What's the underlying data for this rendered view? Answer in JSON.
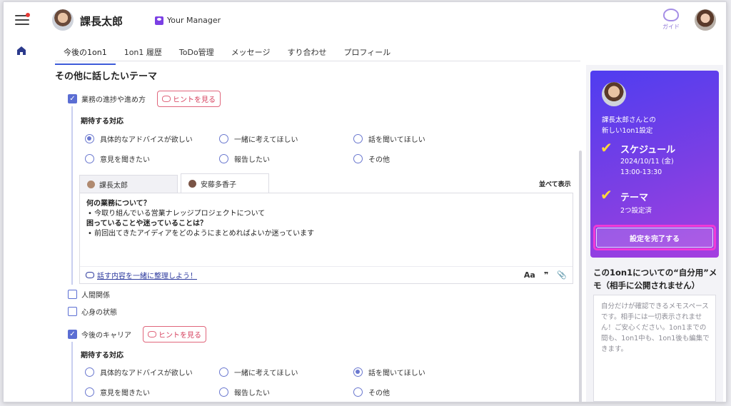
{
  "header": {
    "user_name": "課長太郎",
    "manager_badge": "Your Manager",
    "guide_label": "ガイド"
  },
  "tabs": [
    {
      "label": "今後の1on1",
      "active": true
    },
    {
      "label": "1on1 履歴"
    },
    {
      "label": "ToDo管理"
    },
    {
      "label": "メッセージ"
    },
    {
      "label": "すり合わせ"
    },
    {
      "label": "プロフィール"
    }
  ],
  "main": {
    "section_title": "その他に話したいテーマ",
    "hint_label": "ヒントを見る",
    "expected_label": "期待する対応",
    "themes": [
      {
        "label": "業務の進捗や進め方",
        "checked": true
      },
      {
        "label": "人間関係",
        "checked": false
      },
      {
        "label": "心身の状態",
        "checked": false
      },
      {
        "label": "今後のキャリア",
        "checked": true
      }
    ],
    "options": [
      "具体的なアドバイスが欲しい",
      "一緒に考えてほしい",
      "話を聞いてほしい",
      "意見を聞きたい",
      "報告したい",
      "その他"
    ],
    "group1_selected": 0,
    "group2_selected": 2,
    "note_tabs": [
      "課長太郎",
      "安藤多香子"
    ],
    "side_by_side": "並べて表示",
    "note_lines": [
      {
        "text": "何の業務について？",
        "bold": true
      },
      {
        "text": "• 今取り組んでいる営業ナレッジプロジェクトについて",
        "bold": false
      },
      {
        "text": "困っていることや迷っていることは？",
        "bold": true
      },
      {
        "text": "• 前回出てきたアイディアをどのようにまとめればよいか迷っています",
        "bold": false
      }
    ],
    "organize_link": "話す内容を一緒に整理しよう！",
    "format_icons": [
      "Aa",
      "❞",
      "📎"
    ]
  },
  "card": {
    "subtitle_line1": "課長太郎さんとの",
    "subtitle_line2": "新しい1on1設定",
    "schedule_title": "スケジュール",
    "schedule_date": "2024/10/11 (金)",
    "schedule_time": "13:00-13:30",
    "theme_title": "テーマ",
    "theme_status": "2つ設定済",
    "complete_button": "設定を完了する"
  },
  "memo": {
    "title": "この1on1についての“自分用”メモ（相手に公開されません）",
    "placeholder": "自分だけが確認できるメモスペースです。相手には一切表示されません！ご安心ください。1on1までの間も、1on1中も、1on1後も編集できます。"
  },
  "colors": {
    "accent": "#5b6ed3",
    "tab_underline": "#3d5bd9",
    "hint": "#d6415e",
    "card_gradient_start": "#4f3df0",
    "card_gradient_end": "#a53fe0",
    "highlight_outline": "#f03bd6"
  }
}
